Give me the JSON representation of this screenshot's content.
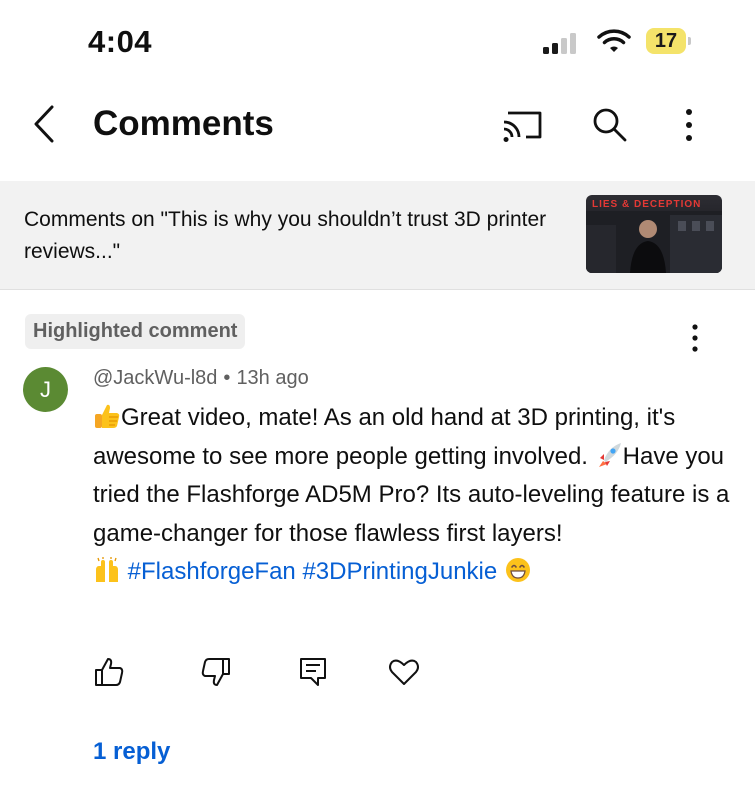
{
  "status_bar": {
    "time": "4:04",
    "battery": "17",
    "icons": [
      "signal-icon",
      "wifi-icon",
      "battery-icon"
    ]
  },
  "header": {
    "title": "Comments",
    "icons": [
      "back-arrow-icon",
      "cast-icon",
      "search-icon",
      "more-vertical-icon"
    ]
  },
  "video": {
    "comments_on": "Comments on \"This is why you shouldn’t trust 3D printer reviews...\"",
    "thumbnail_text": "LIES & DECEPTION"
  },
  "comment": {
    "badge": "Highlighted comment",
    "avatar_letter": "J",
    "author": "@JackWu-l8d",
    "separator": "•",
    "time": "13h ago",
    "body_part1": "Great video, mate! As an old hand at 3D printing, it's awesome to see more people getting involved. ",
    "body_part2": "Have you tried the Flashforge AD5M Pro? Its auto-leveling feature is a game-changer for those flawless first layers!",
    "hashtag1": "#FlashforgeFan",
    "hashtag2": "#3DPrintingJunkie",
    "emojis": [
      "thumbs-up-emoji",
      "rocket-emoji",
      "raised-hands-emoji",
      "grinning-face-emoji"
    ],
    "action_icons": [
      "like-icon",
      "dislike-icon",
      "reply-icon",
      "heart-icon"
    ],
    "replies": "1 reply"
  },
  "colors": {
    "link": "#065fd4",
    "avatar": "#5b8a33",
    "battery": "#f4e36a",
    "strip": "#f2f2f2",
    "muted": "#606060"
  }
}
